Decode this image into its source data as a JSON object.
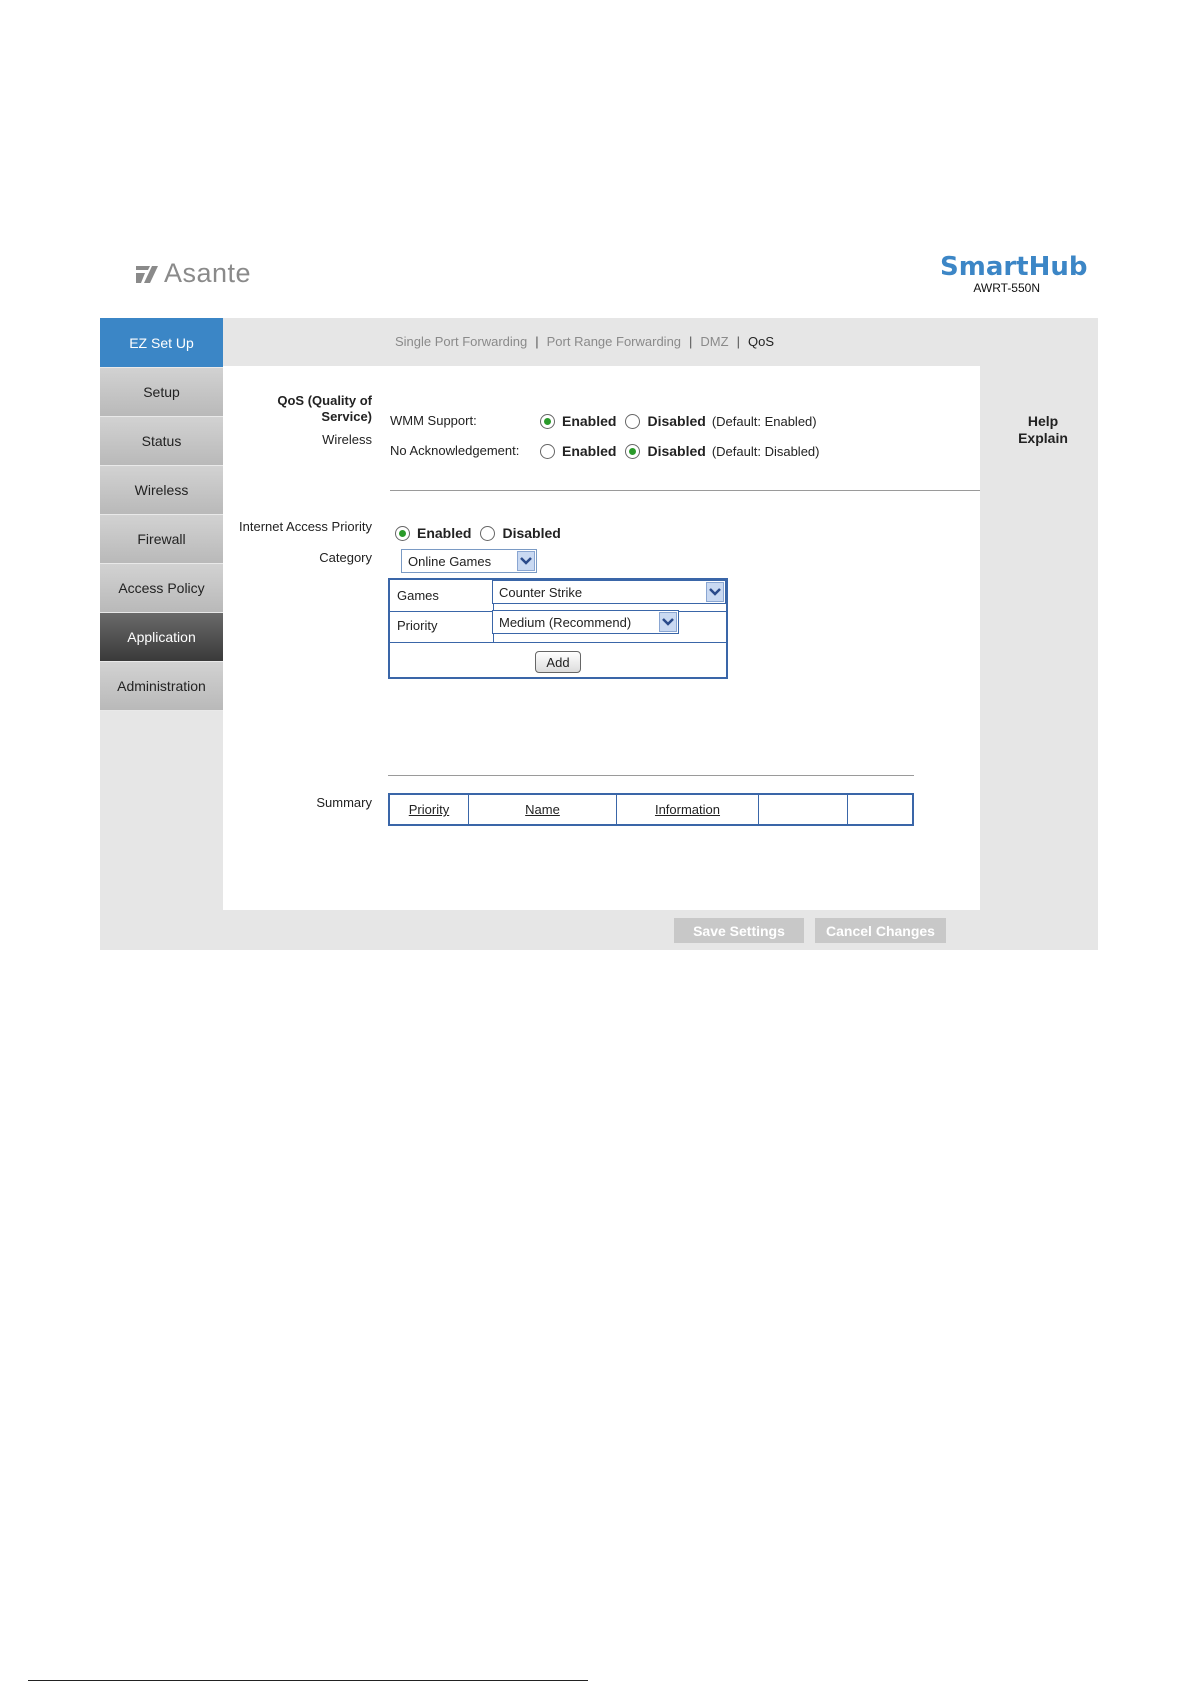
{
  "header": {
    "brand": "Asante",
    "product_name": "SmartHub",
    "model": "AWRT-550N"
  },
  "sidebar": {
    "items": [
      {
        "label": "EZ Set Up"
      },
      {
        "label": "Setup"
      },
      {
        "label": "Status"
      },
      {
        "label": "Wireless"
      },
      {
        "label": "Firewall"
      },
      {
        "label": "Access Policy"
      },
      {
        "label": "Application"
      },
      {
        "label": "Administration"
      }
    ]
  },
  "tabs": {
    "items": [
      "Single Port Forwarding",
      "Port Range Forwarding",
      "DMZ",
      "QoS"
    ],
    "separator": "|",
    "active": "QoS"
  },
  "qos": {
    "section_title_line1": "QoS (Quality of",
    "section_title_line2": "Service)",
    "wireless_label": "Wireless",
    "wmm_label": "WMM Support:",
    "wmm_enabled": "Enabled",
    "wmm_disabled": "Disabled",
    "wmm_default": "(Default: Enabled)",
    "ack_label": "No Acknowledgement:",
    "ack_enabled": "Enabled",
    "ack_disabled": "Disabled",
    "ack_default": "(Default: Disabled)"
  },
  "priority": {
    "label": "Internet Access Priority",
    "enabled": "Enabled",
    "disabled": "Disabled",
    "category_label": "Category",
    "category_value": "Online Games",
    "games_label": "Games",
    "games_value": "Counter Strike",
    "priority_label": "Priority",
    "priority_value": "Medium (Recommend)",
    "add_label": "Add"
  },
  "summary": {
    "label": "Summary",
    "columns": [
      "Priority",
      "Name",
      "Information",
      "",
      ""
    ]
  },
  "help": {
    "line1": "Help",
    "line2": "Explain"
  },
  "actions": {
    "save": "Save Settings",
    "cancel": "Cancel Changes"
  },
  "colors": {
    "accent_blue": "#3b86c6",
    "radio_selected": "#2a9a2a",
    "table_border": "#3a66a8"
  }
}
